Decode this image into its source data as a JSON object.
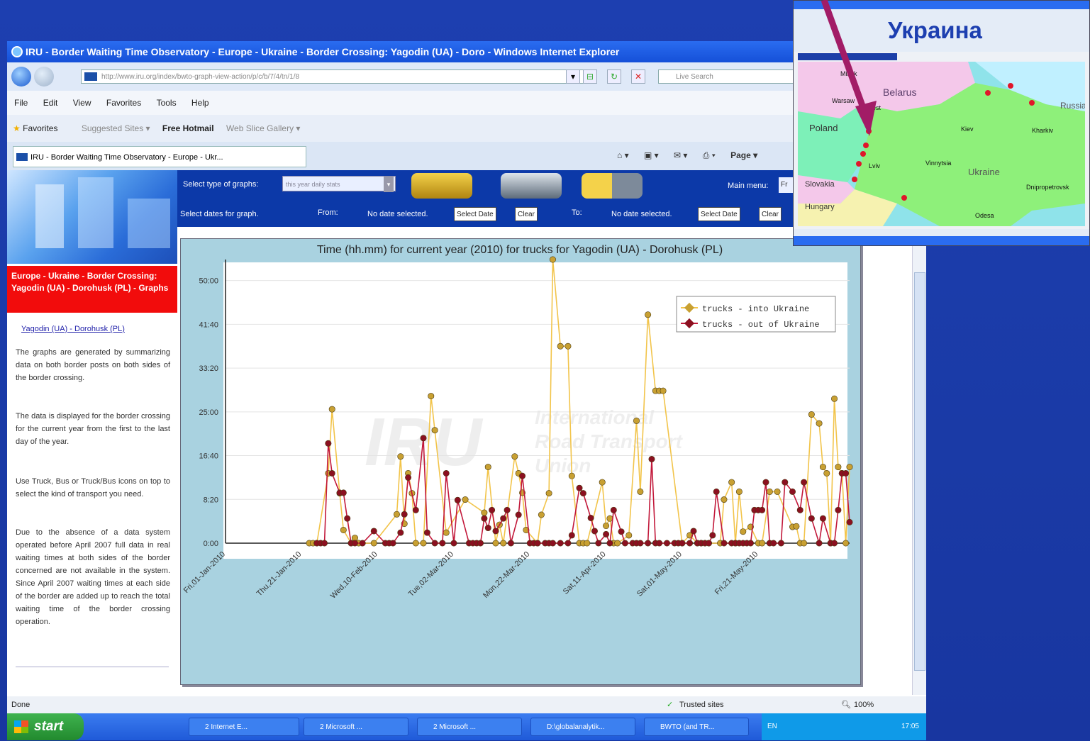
{
  "browser": {
    "title": "IRU - Border Waiting Time Observatory - Europe - Ukraine - Border Crossing: Yagodin (UA) - Doro - Windows Internet Explorer",
    "url": "http://www.iru.org/index/bwto-graph-view-action/p/c/b/7/4/tn/1/8",
    "search_placeholder": "Live Search",
    "menu": [
      "File",
      "Edit",
      "View",
      "Favorites",
      "Tools",
      "Help"
    ],
    "favorites_label": "Favorites",
    "favorite_links": [
      "Suggested Sites ▾",
      "Free Hotmail",
      "Web Slice Gallery ▾"
    ],
    "tab_title": "IRU - Border Waiting Time Observatory - Europe - Ukr...",
    "page_menu": "Page ▾",
    "status_left": "Done",
    "status_trusted": "Trusted sites",
    "zoom": "100%"
  },
  "page": {
    "select_graph_label": "Select type of graphs:",
    "graph_type_value": "this year daily stats",
    "main_menu_label": "Main menu:",
    "main_menu_value": "Fr",
    "select_dates_label": "Select dates for graph.",
    "from_label": "From:",
    "no_date_1": "No date selected.",
    "select_date_btn": "Select Date",
    "clear_btn": "Clear",
    "to_label": "To:",
    "no_date_2": "No date selected.",
    "heading": "Europe - Ukraine - Border Crossing: Yagodin (UA) - Dorohusk (PL) - Graphs",
    "link_a": "Yagodin (UA)",
    "link_sep": " - ",
    "link_b": "Dorohusk (PL)",
    "para1": "The graphs are generated by summarizing data on both border posts on both sides of the border crossing.",
    "para2": "The data is displayed for the border crossing for the current year from the first to the last day of the year.",
    "para3": "Use Truck, Bus or Truck/Bus icons on top to select the kind of transport you need.",
    "para4": "Due to the absence of a data system operated before April 2007 full data in real waiting times at both sides of the border concerned are not available in the system. Since April 2007 waiting times at each side of the border are added up to reach the total waiting time of the border crossing operation."
  },
  "chart_data": {
    "type": "line",
    "title": "Time (hh.mm) for current year (2010) for trucks for Yagodin (UA) - Dorohusk (PL)",
    "y_ticks": [
      "0:00",
      "8:20",
      "16:40",
      "25:00",
      "33:20",
      "41:40",
      "50:00"
    ],
    "ylim_hours": [
      0,
      54
    ],
    "x_range_days": [
      0,
      164
    ],
    "x_tick_labels": [
      "Fri,01-Jan-2010",
      "Thu,21-Jan-2010",
      "Wed,10-Feb-2010",
      "Tue,02-Mar-2010",
      "Mon,22-Mar-2010",
      "Sat,11-Apr-2010",
      "Sat,01-May-2010",
      "Fri,21-May-2010"
    ],
    "watermark": [
      "IRU",
      "International",
      "Road Transport",
      "Union"
    ],
    "series": [
      {
        "name": "trucks - into Ukraine",
        "color": "#f2c44a",
        "marker": "#c8a032",
        "x": [
          22,
          23,
          24,
          27,
          28,
          30,
          31,
          33,
          34,
          35,
          39,
          45,
          46,
          47,
          48,
          49,
          50,
          52,
          54,
          55,
          58,
          63,
          68,
          69,
          71,
          72,
          73,
          76,
          77,
          78,
          79,
          82,
          83,
          85,
          86,
          88,
          90,
          91,
          93,
          94,
          95,
          99,
          100,
          101,
          102,
          103,
          106,
          108,
          109,
          111,
          113,
          114,
          115,
          120,
          122,
          124,
          125,
          126,
          127,
          130,
          131,
          133,
          134,
          135,
          136,
          138,
          140,
          141,
          143,
          145,
          149,
          150,
          151,
          152,
          154,
          156,
          157,
          158,
          159,
          160,
          161,
          162,
          163,
          164
        ],
        "y": [
          0,
          0,
          0,
          13.3,
          25.5,
          9.5,
          2.5,
          0,
          1,
          0,
          0,
          5.5,
          16.5,
          3.7,
          13.3,
          9.5,
          0,
          0,
          28,
          21.5,
          2,
          8.3,
          5.8,
          14.5,
          0,
          3.5,
          0,
          16.5,
          13.3,
          9.6,
          2.5,
          0,
          5.4,
          9.5,
          54,
          37.5,
          37.5,
          12.8,
          0,
          0,
          0,
          11.6,
          3.3,
          4.7,
          0,
          0,
          1.5,
          23.3,
          9.8,
          43.5,
          29,
          29,
          29,
          0,
          1.5,
          0,
          0,
          0,
          0,
          0,
          8.3,
          11.6,
          0,
          9.8,
          2.2,
          3.1,
          0,
          0,
          9.8,
          9.8,
          3.1,
          3.2,
          0,
          0,
          24.5,
          22.8,
          14.5,
          13.3,
          0,
          27.5,
          14.5,
          13.3,
          0,
          14.5
        ]
      },
      {
        "name": "trucks - out of Ukraine",
        "color": "#c2183a",
        "marker": "#8b1020",
        "x": [
          24,
          25,
          26,
          27,
          28,
          30,
          31,
          32,
          33,
          34,
          36,
          39,
          42,
          43,
          44,
          46,
          47,
          48,
          50,
          52,
          53,
          55,
          57,
          58,
          60,
          61,
          64,
          65,
          66,
          67,
          68,
          69,
          70,
          71,
          73,
          74,
          75,
          77,
          78,
          80,
          81,
          82,
          84,
          85,
          86,
          88,
          90,
          91,
          93,
          94,
          96,
          97,
          98,
          100,
          101,
          102,
          104,
          105,
          107,
          108,
          109,
          111,
          112,
          113,
          114,
          116,
          118,
          119,
          120,
          122,
          123,
          124,
          125,
          126,
          127,
          128,
          129,
          131,
          133,
          134,
          135,
          136,
          137,
          138,
          139,
          140,
          141,
          142,
          143,
          144,
          146,
          147,
          149,
          151,
          152,
          154,
          156,
          157,
          159,
          160,
          161,
          162,
          163,
          164
        ],
        "y": [
          0,
          0,
          0,
          19,
          13.3,
          9.6,
          9.6,
          4.7,
          0,
          0,
          0,
          2.3,
          0,
          0,
          0,
          2,
          5.5,
          12.5,
          6.3,
          20,
          2,
          0,
          0,
          13.3,
          0,
          8.2,
          0,
          0,
          0,
          0,
          4.7,
          2.9,
          6.3,
          2.3,
          4.7,
          6.3,
          0,
          5.4,
          12.8,
          0,
          0,
          0,
          0,
          0,
          0,
          0,
          0,
          1.5,
          10.5,
          9.5,
          4.8,
          2.3,
          0,
          1.7,
          0,
          6.3,
          2.2,
          0,
          0,
          0,
          0,
          0,
          16,
          0,
          0,
          0,
          0,
          0,
          0,
          0,
          2.3,
          0,
          0,
          0,
          0,
          1.5,
          9.8,
          0,
          0,
          0,
          0,
          0,
          0,
          0,
          6.3,
          6.3,
          6.3,
          11.6,
          0,
          0,
          0,
          11.6,
          9.8,
          6.3,
          11.6,
          4.7,
          0,
          4.7,
          0,
          0,
          6.3,
          13.3,
          13.3,
          4
        ]
      }
    ]
  },
  "taskbar": {
    "start": "start",
    "tasks": [
      "2 Internet E...",
      "2 Microsoft ...",
      "2 Microsoft ...",
      "D:\\globalanalytik...",
      "BWTO (and TR..."
    ],
    "tray_lang": "EN",
    "clock": "17:05"
  },
  "inset": {
    "label": "Украина",
    "countries": [
      "Belarus",
      "Poland",
      "Slovakia",
      "Hungary",
      "Ukraine",
      "Russia"
    ],
    "cities": [
      "Minsk",
      "Warsaw",
      "Kiev",
      "Kharkiv",
      "Odesa",
      "Lviv",
      "Brest",
      "Vinnytsia",
      "Dnipropetrovsk"
    ],
    "arrow_color": "#a21c66",
    "border_dot_color": "#e0162a"
  }
}
